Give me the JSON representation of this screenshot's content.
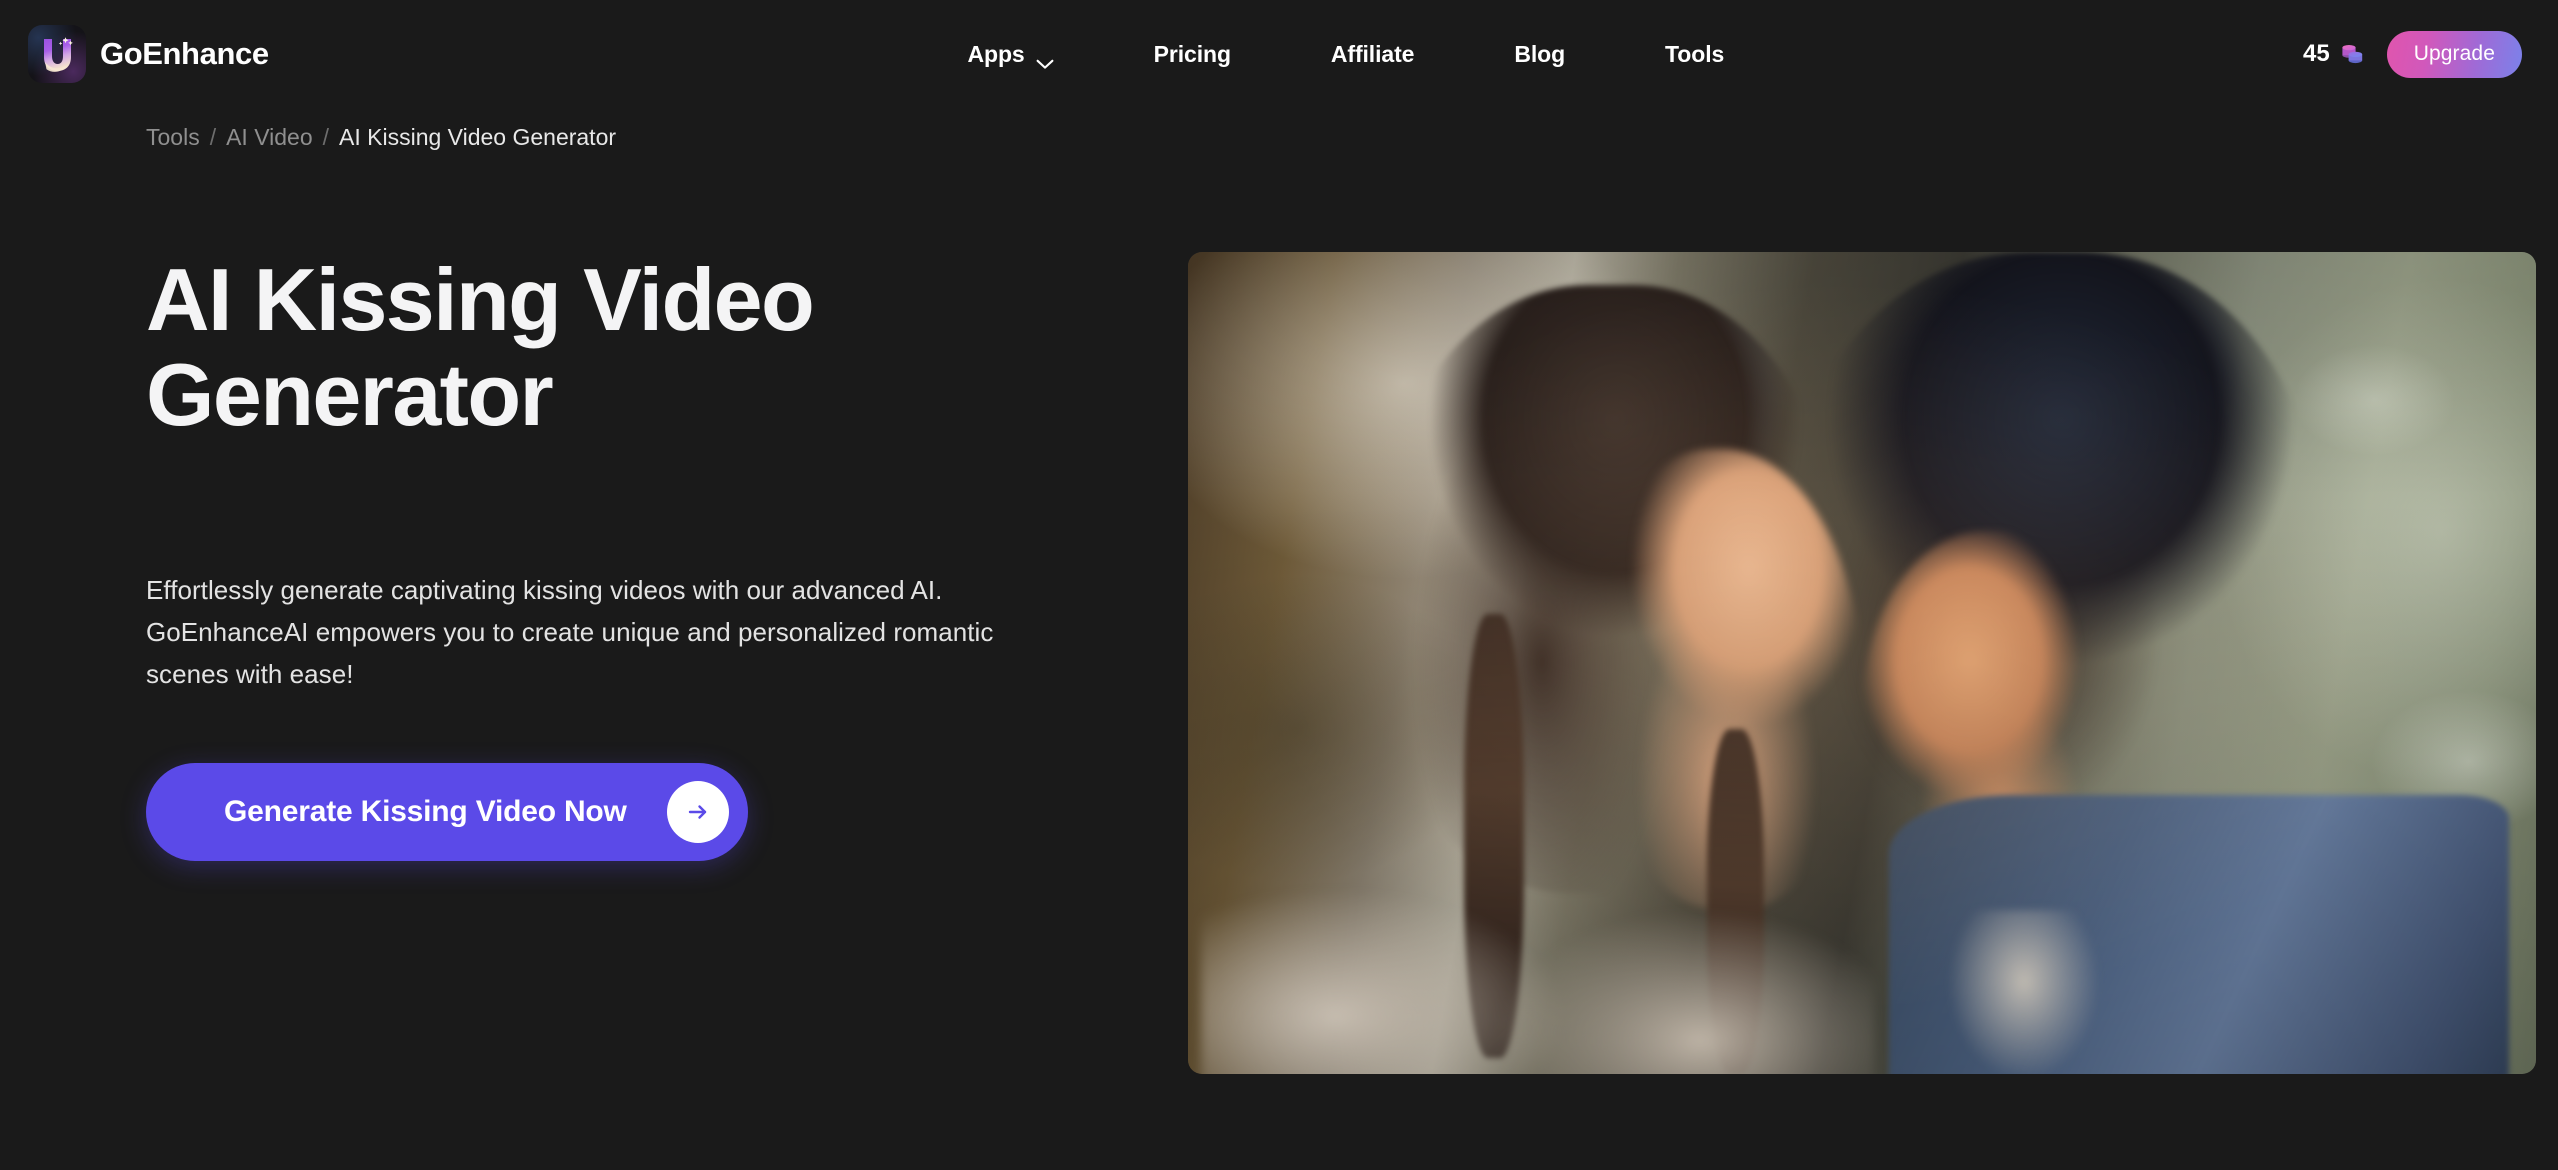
{
  "brand": {
    "name": "GoEnhance",
    "logo_icon": "goenhance-u-sparkle-logo"
  },
  "nav": {
    "items": [
      {
        "label": "Apps",
        "has_dropdown": true,
        "icon": "chevron-down-icon"
      },
      {
        "label": "Pricing",
        "has_dropdown": false
      },
      {
        "label": "Affiliate",
        "has_dropdown": false
      },
      {
        "label": "Blog",
        "has_dropdown": false
      },
      {
        "label": "Tools",
        "has_dropdown": false
      }
    ]
  },
  "header_right": {
    "credits_count": "45",
    "credits_icon": "coins-icon",
    "upgrade_label": "Upgrade"
  },
  "breadcrumb": {
    "items": [
      {
        "label": "Tools",
        "current": false
      },
      {
        "label": "AI Video",
        "current": false
      },
      {
        "label": "AI Kissing Video Generator",
        "current": true
      }
    ],
    "separator": "/"
  },
  "hero": {
    "title_line1": "AI Kissing Video",
    "title_line2": "Generator",
    "description": "Effortlessly generate captivating kissing videos with our advanced AI. GoEnhanceAI empowers you to create unique and personalized romantic scenes with ease!",
    "cta_label": "Generate Kissing Video Now",
    "cta_icon": "arrow-right-icon",
    "media_alt": "Couple kissing — AI generated romantic video preview"
  },
  "colors": {
    "page_background": "#1a1a1a",
    "cta_background": "#5b4ae8",
    "upgrade_gradient_start": "#e055ad",
    "upgrade_gradient_end": "#7b82ea",
    "text_primary": "#ffffff",
    "text_muted": "#8f8f8f"
  }
}
